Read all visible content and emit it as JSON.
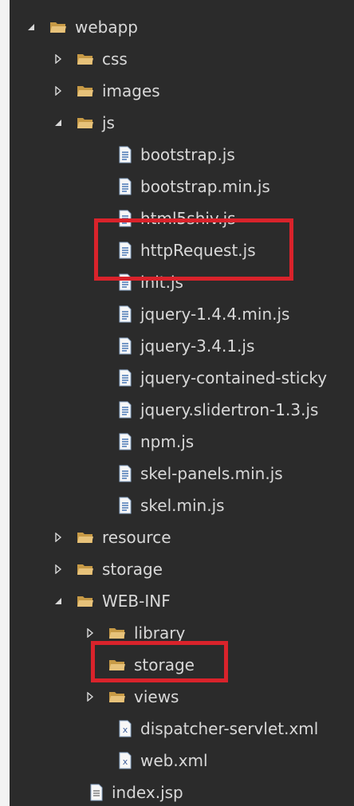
{
  "tree": {
    "webapp": "webapp",
    "css": "css",
    "images": "images",
    "js": "js",
    "js_files": [
      "bootstrap.js",
      "bootstrap.min.js",
      "html5shiv.js",
      "httpRequest.js",
      "init.js",
      "jquery-1.4.4.min.js",
      "jquery-3.4.1.js",
      "jquery-contained-sticky",
      "jquery.slidertron-1.3.js",
      "npm.js",
      "skel-panels.min.js",
      "skel.min.js"
    ],
    "resource": "resource",
    "storage": "storage",
    "webinf": "WEB-INF",
    "library": "library",
    "webinf_storage": "storage",
    "views": "views",
    "dispatcher": "dispatcher-servlet.xml",
    "webxml": "web.xml",
    "indexjsp": "index.jsp"
  },
  "colors": {
    "background": "#2b2b2b",
    "text": "#d8d8d8",
    "folder": "#d6b36a",
    "highlight": "#d9232b"
  }
}
